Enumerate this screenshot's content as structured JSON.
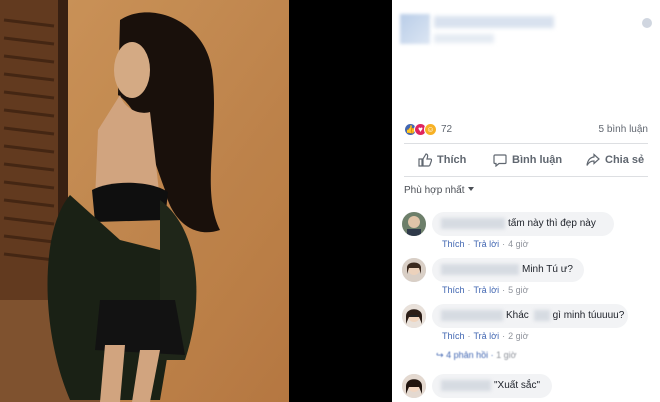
{
  "post": {
    "reactions": {
      "count": "72",
      "icons": [
        "like-icon",
        "love-icon",
        "haha-icon"
      ]
    },
    "comments_count": "5 bình luận"
  },
  "actions": {
    "like_label": "Thích",
    "comment_label": "Bình luận",
    "share_label": "Chia sẻ"
  },
  "sort": {
    "label": "Phù hợp nhất"
  },
  "comments": [
    {
      "text": "tấm này thì đẹp này",
      "like": "Thích",
      "reply": "Trả lời",
      "time": "4 giờ"
    },
    {
      "text": "Minh Tú ư?",
      "like": "Thích",
      "reply": "Trả lời",
      "time": "5 giờ"
    },
    {
      "text_a": "Khác",
      "text_b": "gì minh túuuuu?",
      "like": "Thích",
      "reply": "Trả lời",
      "time": "2 giờ"
    },
    {
      "text": "\"Xuất sắc\""
    }
  ],
  "replies": {
    "label": "4 phản hồi",
    "time": "1 giờ"
  },
  "colors": {
    "accent": "#4267b2",
    "panel_bg": "#ffffff",
    "bubble_bg": "#f2f3f5",
    "backdrop": "#000000"
  }
}
